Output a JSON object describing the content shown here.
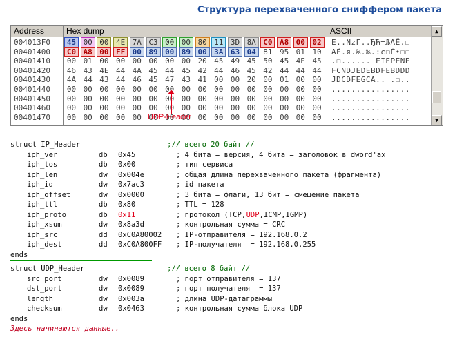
{
  "title": "Структура перехваченного сниффером пакета",
  "dump": {
    "headers": {
      "address": "Address",
      "hex": "Hex dump",
      "ascii": "ASCII"
    },
    "rows": [
      {
        "addr": "004013F0",
        "bytes": [
          "45",
          "00",
          "00",
          "4E",
          "7A",
          "C3",
          "00",
          "00",
          "80",
          "11",
          "3D",
          "8A",
          "C0",
          "A8",
          "00",
          "02"
        ],
        "ascii": "E..NzГ..ЂЋ=ЉАЁ.☐"
      },
      {
        "addr": "00401400",
        "bytes": [
          "C0",
          "A8",
          "00",
          "FF",
          "00",
          "89",
          "00",
          "89",
          "00",
          "3A",
          "63",
          "04",
          "81",
          "95",
          "01",
          "10"
        ],
        "ascii": "АЁ.я.‰.‰.:c☐Ѓ•☐☐"
      },
      {
        "addr": "00401410",
        "bytes": [
          "00",
          "01",
          "00",
          "00",
          "00",
          "00",
          "00",
          "00",
          "20",
          "45",
          "49",
          "45",
          "50",
          "45",
          "4E",
          "45"
        ],
        "ascii": ".☐...... EIEPENE"
      },
      {
        "addr": "00401420",
        "bytes": [
          "46",
          "43",
          "4E",
          "44",
          "4A",
          "45",
          "44",
          "45",
          "42",
          "44",
          "46",
          "45",
          "42",
          "44",
          "44",
          "44"
        ],
        "ascii": "FCNDJEDEBDFEBDDD"
      },
      {
        "addr": "00401430",
        "bytes": [
          "4A",
          "44",
          "43",
          "44",
          "46",
          "45",
          "47",
          "43",
          "41",
          "00",
          "00",
          "20",
          "00",
          "01",
          "00",
          "00"
        ],
        "ascii": "JDCDFEGCA.. .☐.."
      },
      {
        "addr": "00401440",
        "bytes": [
          "00",
          "00",
          "00",
          "00",
          "00",
          "00",
          "00",
          "00",
          "00",
          "00",
          "00",
          "00",
          "00",
          "00",
          "00",
          "00"
        ],
        "ascii": "................"
      },
      {
        "addr": "00401450",
        "bytes": [
          "00",
          "00",
          "00",
          "00",
          "00",
          "00",
          "00",
          "00",
          "00",
          "00",
          "00",
          "00",
          "00",
          "00",
          "00",
          "00"
        ],
        "ascii": "................"
      },
      {
        "addr": "00401460",
        "bytes": [
          "00",
          "00",
          "00",
          "00",
          "00",
          "00",
          "00",
          "00",
          "00",
          "00",
          "00",
          "00",
          "00",
          "00",
          "00",
          "00"
        ],
        "ascii": "................"
      },
      {
        "addr": "00401470",
        "bytes": [
          "00",
          "00",
          "00",
          "00",
          "00",
          "00",
          "00",
          "00",
          "00",
          "00",
          "00",
          "00",
          "00",
          "00",
          "00",
          "00"
        ],
        "ascii": "................"
      }
    ],
    "udp_label": "UDP-Header"
  },
  "ip_struct": {
    "open": "struct IP_Header",
    "open_comment": ";// всего 20 байт //",
    "fields": [
      {
        "name": "iph_ver",
        "type": "db",
        "value": "0x45",
        "comment": "; 4 бита = версия, 4 бита = заголовок в dword'ax"
      },
      {
        "name": "iph_tos",
        "type": "db",
        "value": "0x00",
        "comment": "; тип сервиса"
      },
      {
        "name": "iph_len",
        "type": "dw",
        "value": "0x004e",
        "comment": "; общая длина перехваченного пакета (фрагмента)"
      },
      {
        "name": "iph_id",
        "type": "dw",
        "value": "0x7ac3",
        "comment": "; id пакета"
      },
      {
        "name": "iph_offset",
        "type": "dw",
        "value": "0x0000",
        "comment": "; 3 бита = флаги, 13 бит = смещение пакета"
      },
      {
        "name": "iph_ttl",
        "type": "db",
        "value": "0x80",
        "comment": "; TTL = 128"
      },
      {
        "name": "iph_proto",
        "type": "db",
        "value": "0x11",
        "comment_pre": "; протокол (TCP,",
        "comment_hl": "UDP",
        "comment_post": ",ICMP,IGMP)"
      },
      {
        "name": "iph_xsum",
        "type": "dw",
        "value": "0x8a3d",
        "comment": "; контрольная сумма = CRC"
      },
      {
        "name": "iph_src",
        "type": "dd",
        "value": "0xC0A80002",
        "comment": "; IP-отправителя = 192.168.0.2"
      },
      {
        "name": "iph_dest",
        "type": "dd",
        "value": "0xC0A800FF",
        "comment": "; IP-получателя  = 192.168.0.255"
      }
    ],
    "close": "ends"
  },
  "udp_struct": {
    "open": "struct UDP_Header",
    "open_comment": ";// всего 8 байт //",
    "fields": [
      {
        "name": "src_port",
        "type": "dw",
        "value": "0x0089",
        "comment": "; порт отправителя = 137"
      },
      {
        "name": "dst_port",
        "type": "dw",
        "value": "0x0089",
        "comment": "; порт получателя  = 137"
      },
      {
        "name": "length",
        "type": "dw",
        "value": "0x003a",
        "comment": "; длина UDP-датаграммы"
      },
      {
        "name": "checksum",
        "type": "dw",
        "value": "0x0463",
        "comment": "; контрольная сумма блока UDP"
      }
    ],
    "close": "ends"
  },
  "footer": "Здесь начинаются данные..",
  "colors": {
    "title": "#1f4e9c",
    "highlight_red": "#e0001a",
    "comment_green": "#006600",
    "separator_green": "#009900"
  },
  "byte_styles": {
    "r0": [
      "blue",
      "magenta",
      "olive",
      "olive",
      "gray",
      "gray",
      "green",
      "green",
      "orange",
      "cyan",
      "gray",
      "gray",
      "red",
      "red",
      "red",
      "red"
    ],
    "r1": [
      "red",
      "red",
      "red",
      "red",
      "steel",
      "steel",
      "steel",
      "steel",
      "steel",
      "steel",
      "steel",
      "steel",
      "",
      "",
      "",
      ""
    ]
  }
}
